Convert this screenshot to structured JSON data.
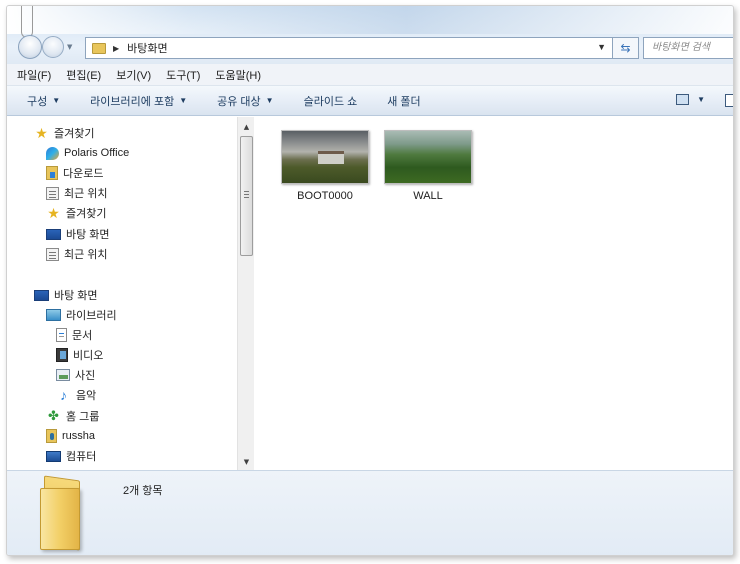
{
  "address": {
    "location": "바탕화면",
    "search_placeholder": "바탕화면 검색"
  },
  "menubar": [
    "파일(F)",
    "편집(E)",
    "보기(V)",
    "도구(T)",
    "도움말(H)"
  ],
  "toolbar": {
    "items": [
      "구성",
      "라이브러리에 포함",
      "공유 대상",
      "슬라이드 쇼",
      "새 폴더"
    ]
  },
  "nav": [
    {
      "label": "즐겨찾기",
      "icon": "star-icon"
    },
    {
      "label": "Polaris Office",
      "icon": "polaris-icon"
    },
    {
      "label": "다운로드",
      "icon": "download-folder-icon"
    },
    {
      "label": "최근 위치",
      "icon": "recent-places-icon"
    },
    {
      "label": "즐겨찾기",
      "icon": "star-icon"
    },
    {
      "label": "바탕 화면",
      "icon": "desktop-icon"
    },
    {
      "label": "최근 위치",
      "icon": "recent-places-icon"
    },
    {
      "label": "바탕 화면",
      "icon": "desktop-icon"
    },
    {
      "label": "라이브러리",
      "icon": "library-icon"
    },
    {
      "label": "문서",
      "icon": "documents-icon"
    },
    {
      "label": "비디오",
      "icon": "video-icon"
    },
    {
      "label": "사진",
      "icon": "pictures-icon"
    },
    {
      "label": "음악",
      "icon": "music-icon"
    },
    {
      "label": "홈 그룹",
      "icon": "homegroup-icon"
    },
    {
      "label": "russha",
      "icon": "user-folder-icon"
    },
    {
      "label": "컴퓨터",
      "icon": "computer-icon"
    }
  ],
  "files": [
    {
      "name": "BOOT0000",
      "thumbnail": "landscape-house-thumbnail"
    },
    {
      "name": "WALL",
      "thumbnail": "grass-field-thumbnail"
    }
  ],
  "details": {
    "count": "2개 항목"
  }
}
